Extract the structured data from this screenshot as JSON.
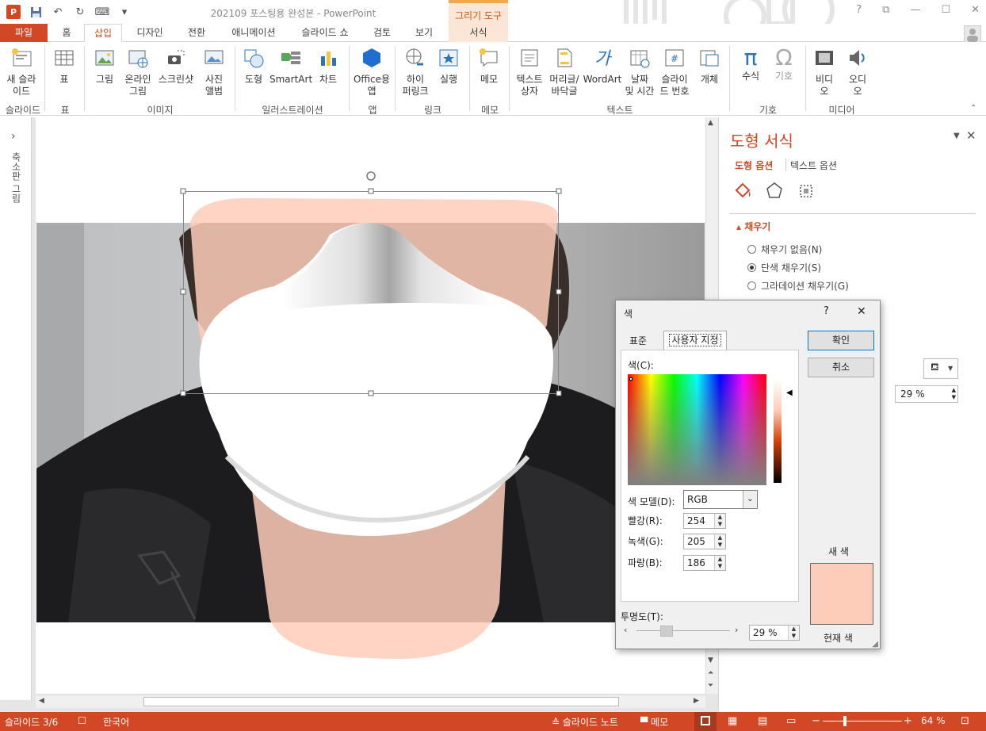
{
  "window": {
    "doc_title": "202109 포스팅용 완성본 - PowerPoint",
    "context_tab_group": "그리기 도구",
    "help": "?",
    "ribbon_display": "⧉",
    "minimize": "—",
    "maximize": "☐",
    "close": "✕"
  },
  "tabs": {
    "file": "파일",
    "home": "홈",
    "insert": "삽입",
    "design": "디자인",
    "transitions": "전환",
    "animations": "애니메이션",
    "slideshow": "슬라이드 쇼",
    "review": "검토",
    "view": "보기",
    "format": "서식"
  },
  "ribbon": {
    "new_slide": "새 슬라\n이드",
    "table": "표",
    "picture": "그림",
    "online_picture": "온라인\n그림",
    "screenshot": "스크린샷",
    "photo_album": "사진\n앨범",
    "shapes": "도형",
    "smartart": "SmartArt",
    "chart": "차트",
    "office_app": "Office용\n앱",
    "hyperlink": "하이\n퍼링크",
    "action": "실행",
    "comment": "메모",
    "textbox": "텍스트\n상자",
    "header_footer": "머리글/\n바닥글",
    "wordart": "WordArt",
    "date_time": "날짜\n및 시간",
    "slide_number": "슬라이\n드 번호",
    "object": "개체",
    "equation": "수식",
    "symbol": "기호",
    "video": "비디\n오",
    "audio": "오디\n오",
    "groups": {
      "slides": "슬라이드",
      "tables": "표",
      "images": "이미지",
      "illustrations": "일러스트레이션",
      "apps": "앱",
      "links": "링크",
      "comments": "메모",
      "text": "텍스트",
      "symbols": "기호",
      "media": "미디어"
    }
  },
  "left_panel": {
    "label": "축소판 그림",
    "expand": "›"
  },
  "format_pane": {
    "title": "도형 서식",
    "tab_shape_options": "도형 옵션",
    "tab_text_options": "텍스트 옵션",
    "section_fill": "채우기",
    "options": [
      "채우기 없음(N)",
      "단색 채우기(S)",
      "그라데이션 채우기(G)"
    ],
    "transparency_value": "29 %"
  },
  "color_dialog": {
    "title": "색",
    "help": "?",
    "close": "✕",
    "tab_standard": "표준",
    "tab_custom": "사용자 지정",
    "colors_label": "색(C):",
    "color_model_label": "색 모델(D):",
    "color_model_value": "RGB",
    "red_label": "빨강(R):",
    "red": "254",
    "green_label": "녹색(G):",
    "green": "205",
    "blue_label": "파랑(B):",
    "blue": "186",
    "transparency_label": "투명도(T):",
    "transparency": "29 %",
    "transparency_fraction": 0.29,
    "ok": "확인",
    "cancel": "취소",
    "new_label": "새 색",
    "current_label": "현재 색",
    "swatch_color": "#FECDBA"
  },
  "status": {
    "slide": "슬라이드 3/6",
    "language": "한국어",
    "notes": "슬라이드 노트",
    "comments": "메모",
    "zoom": "64 %"
  }
}
